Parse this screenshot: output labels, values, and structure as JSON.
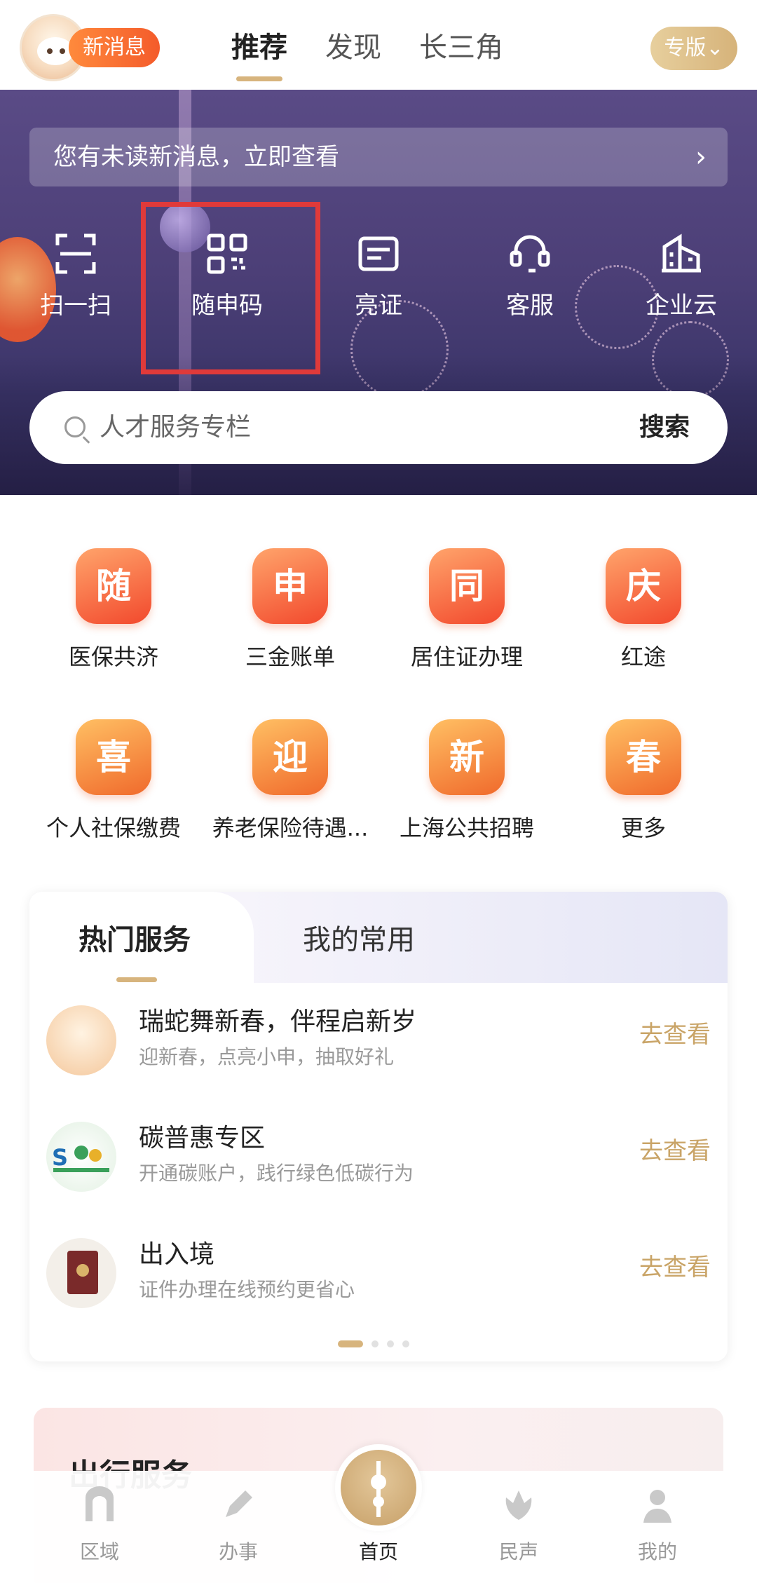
{
  "header": {
    "new_message_badge": "新消息",
    "tabs": [
      {
        "label": "推荐",
        "active": true
      },
      {
        "label": "发现",
        "active": false
      },
      {
        "label": "长三角",
        "active": false
      }
    ],
    "edition_button": "专版⌄"
  },
  "hero": {
    "notice": "您有未读新消息，立即查看",
    "notice_arrow": "›",
    "actions": [
      {
        "label": "扫一扫",
        "icon": "scan-icon"
      },
      {
        "label": "随申码",
        "icon": "qr-code-icon"
      },
      {
        "label": "亮证",
        "icon": "id-card-icon"
      },
      {
        "label": "客服",
        "icon": "customer-service-icon"
      },
      {
        "label": "企业云",
        "icon": "building-icon"
      }
    ],
    "search": {
      "placeholder": "人才服务专栏",
      "button": "搜索"
    }
  },
  "services_grid": [
    {
      "glyph": "随",
      "label": "医保共济"
    },
    {
      "glyph": "申",
      "label": "三金账单"
    },
    {
      "glyph": "同",
      "label": "居住证办理"
    },
    {
      "glyph": "庆",
      "label": "红途"
    },
    {
      "glyph": "喜",
      "label": "个人社保缴费"
    },
    {
      "glyph": "迎",
      "label": "养老保险待遇..."
    },
    {
      "glyph": "新",
      "label": "上海公共招聘"
    },
    {
      "glyph": "春",
      "label": "更多"
    }
  ],
  "hot_services": {
    "tabs": [
      {
        "label": "热门服务",
        "active": true
      },
      {
        "label": "我的常用",
        "active": false
      }
    ],
    "items": [
      {
        "title": "瑞蛇舞新春，伴程启新岁",
        "subtitle": "迎新春，点亮小申，抽取好礼",
        "action": "去查看",
        "icon": "mascot-icon"
      },
      {
        "title": "碳普惠专区",
        "subtitle": "开通碳账户，践行绿色低碳行为",
        "action": "去查看",
        "icon": "carbon-logo-icon"
      },
      {
        "title": "出入境",
        "subtitle": "证件办理在线预约更省心",
        "action": "去查看",
        "icon": "passport-icon"
      }
    ]
  },
  "travel": {
    "title": "出行服务"
  },
  "bottom_nav": [
    {
      "label": "区域",
      "icon": "arch-icon"
    },
    {
      "label": "办事",
      "icon": "pen-icon"
    },
    {
      "label": "首页",
      "icon": "tower-icon",
      "active": true
    },
    {
      "label": "民声",
      "icon": "hands-icon"
    },
    {
      "label": "我的",
      "icon": "person-icon"
    }
  ]
}
